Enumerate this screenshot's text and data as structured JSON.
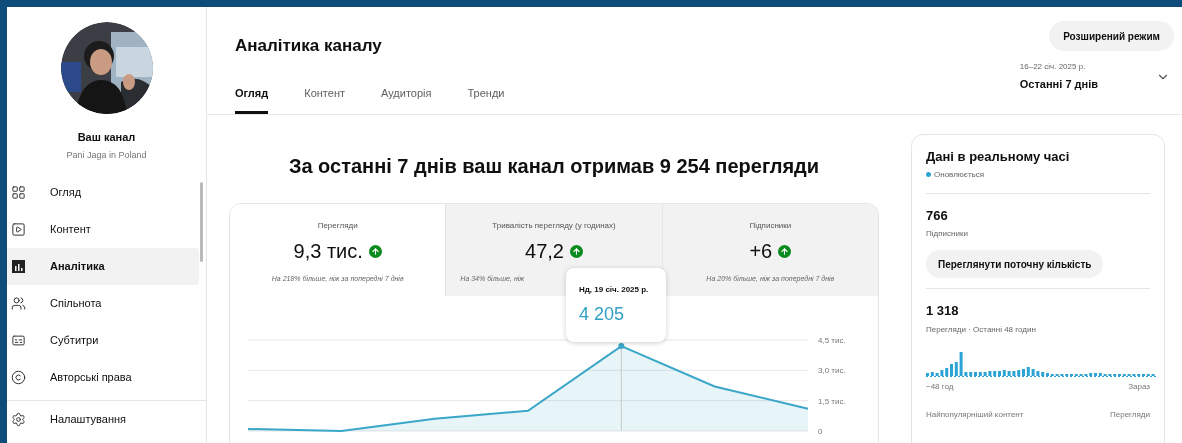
{
  "sidebar": {
    "channel_title": "Ваш канал",
    "channel_name": "Pani Jaga in Poland",
    "items": [
      {
        "label": "Огляд",
        "selected": false
      },
      {
        "label": "Контент",
        "selected": false
      },
      {
        "label": "Аналітика",
        "selected": true
      },
      {
        "label": "Спільнота",
        "selected": false
      },
      {
        "label": "Субтитри",
        "selected": false
      },
      {
        "label": "Авторські права",
        "selected": false
      },
      {
        "label": "Налаштування",
        "selected": false
      }
    ]
  },
  "header": {
    "title": "Аналітика каналу",
    "advanced_button": "Розширений режим",
    "tabs": [
      {
        "label": "Огляд",
        "selected": true
      },
      {
        "label": "Контент",
        "selected": false
      },
      {
        "label": "Аудиторія",
        "selected": false
      },
      {
        "label": "Тренди",
        "selected": false
      }
    ],
    "date_range": {
      "dates": "16–22 січ. 2025 р.",
      "period": "Останні 7 днів"
    }
  },
  "headline": "За останні 7 днів ваш канал отримав 9 254 перегляди",
  "metrics": [
    {
      "label": "Перегляди",
      "value": "9,3 тис.",
      "note": "На 218% більше, ніж за попередні 7 днів",
      "selected": true
    },
    {
      "label": "Тривалість перегляду (у годинах)",
      "value": "47,2",
      "note": "На 34% більше, ніж",
      "selected": false
    },
    {
      "label": "Підписники",
      "value": "+6",
      "note": "На 20% більше, ніж за попередні 7 днів",
      "selected": false
    }
  ],
  "tooltip": {
    "date": "Нд, 19 січ. 2025 р.",
    "value": "4 205"
  },
  "chart_data": {
    "type": "area",
    "ylim": [
      0,
      4.5
    ],
    "yticks": [
      {
        "value": 0,
        "label": "0"
      },
      {
        "value": 1.5,
        "label": "1,5 тис."
      },
      {
        "value": 3,
        "label": "3,0 тис."
      },
      {
        "value": 4.5,
        "label": "4,5 тис."
      }
    ],
    "series": [
      {
        "color": "#3aa6c8",
        "values": [
          0.1,
          0,
          0.6,
          1.0,
          4.2,
          2.2,
          1.1
        ]
      }
    ]
  },
  "realtime": {
    "title": "Дані в реальному часі",
    "status": "Оновлюється",
    "subscribers": "766",
    "subscribers_label": "Підписники",
    "show_count_button": "Переглянути поточну кількість",
    "views": "1 318",
    "views_label": "Перегляди · Останні 48 годин",
    "axis_start": "−48 год",
    "axis_end": "Зараз",
    "top_content": "Найпопулярніший контент",
    "top_views": "Перегляди"
  }
}
